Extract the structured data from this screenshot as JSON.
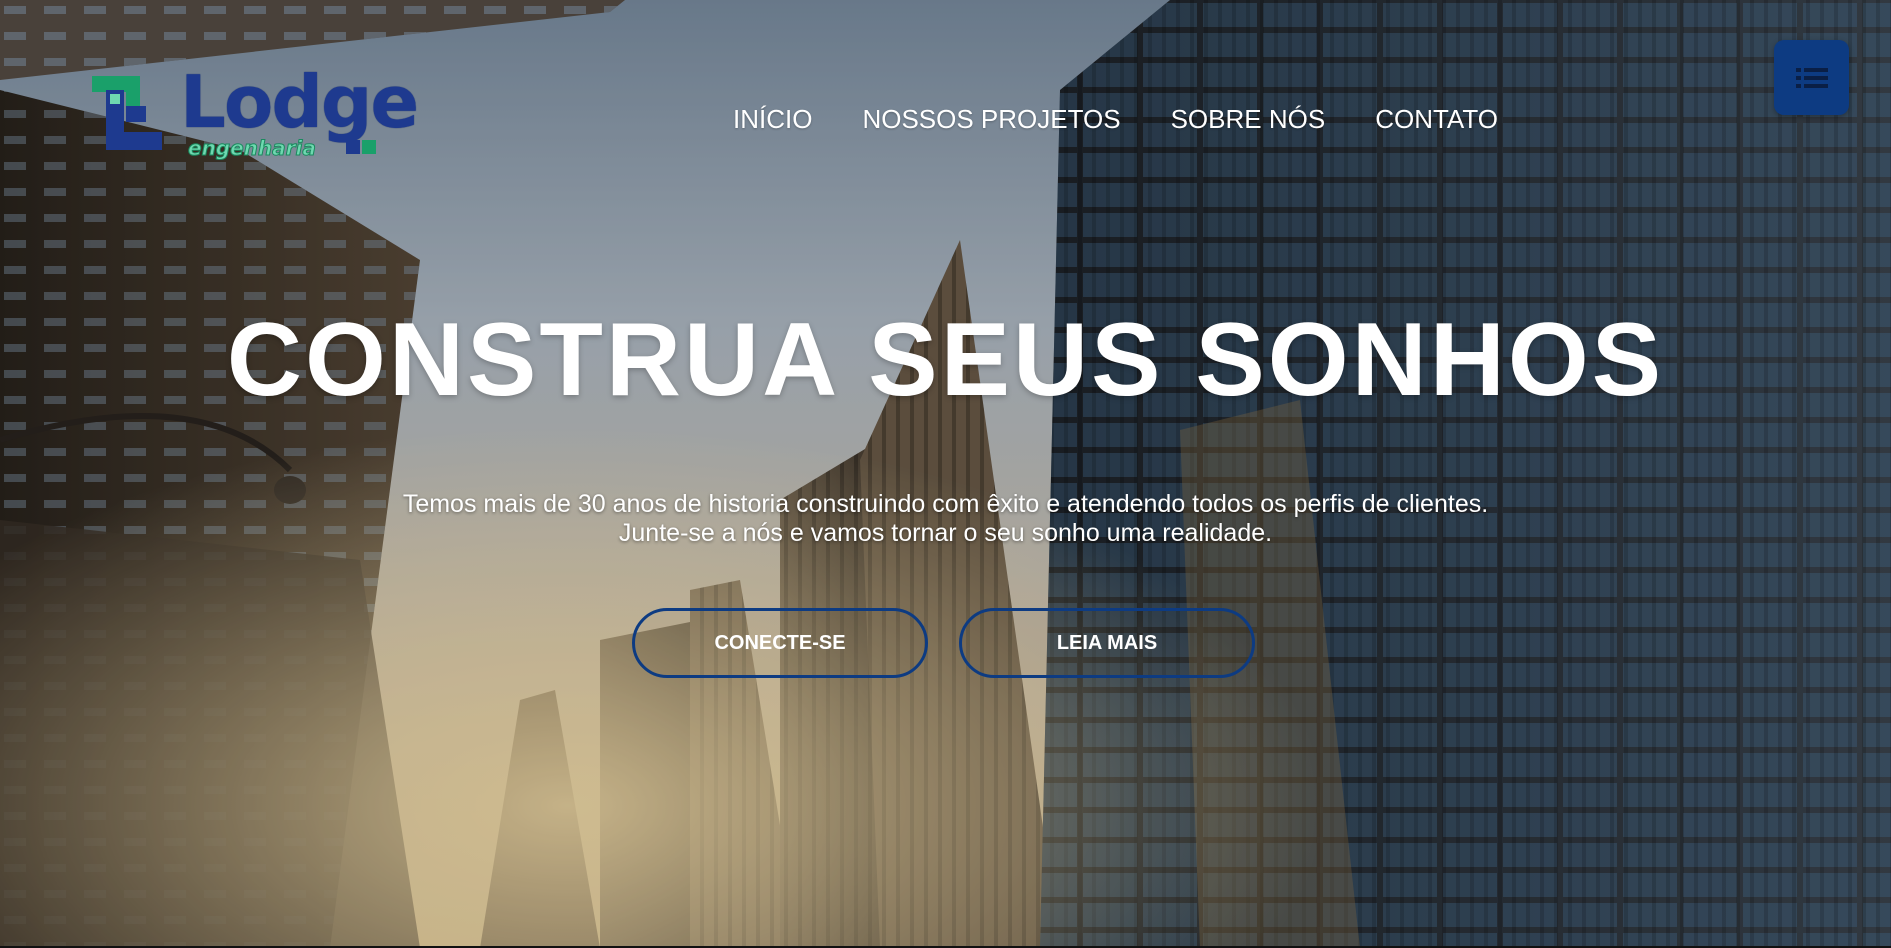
{
  "brand": {
    "name": "Lodge",
    "tagline": "engenharia",
    "colors": {
      "primary_blue": "#1e3a8f",
      "accent_green": "#1a8a5e",
      "button_blue": "#0d3b82"
    }
  },
  "nav": {
    "items": [
      {
        "label": "INÍCIO"
      },
      {
        "label": "NOSSOS PROJETOS"
      },
      {
        "label": "SOBRE NÓS"
      },
      {
        "label": "CONTATO"
      }
    ]
  },
  "menu_button": {
    "icon": "list-icon"
  },
  "hero": {
    "headline": "CONSTRUA SEUS SONHOS",
    "subtext_line1": "Temos mais de 30 anos de historia construindo com êxito e atendendo todos os perfis de clientes.",
    "subtext_line2": "Junte-se a nós e vamos tornar o seu sonho uma realidade.",
    "buttons": [
      {
        "label": "CONECTE-SE"
      },
      {
        "label": "LEIA MAIS"
      }
    ]
  }
}
